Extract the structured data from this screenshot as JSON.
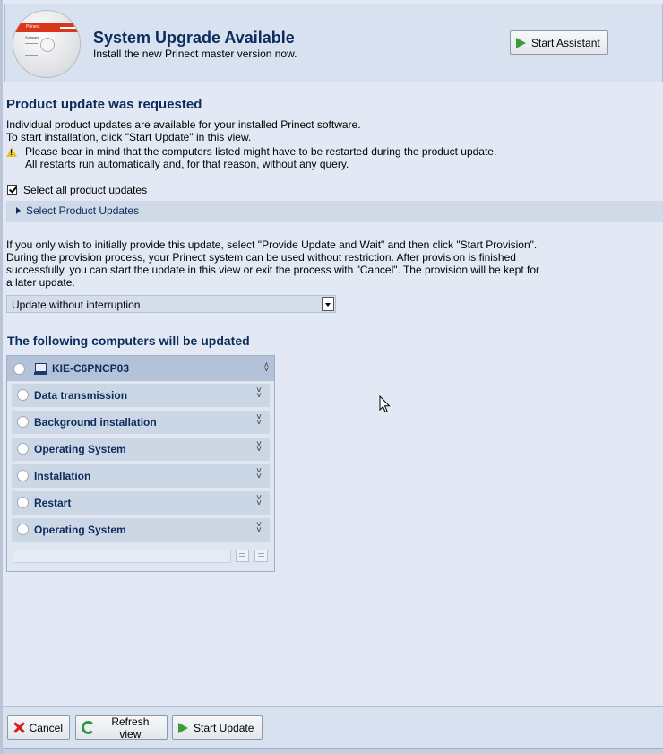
{
  "header": {
    "title": "System Upgrade Available",
    "subtitle": "Install the new Prinect master version now.",
    "assistant_button": "Start Assistant",
    "disc_label": "Prinect",
    "disc_sub": "Software"
  },
  "section": {
    "title": "Product update was requested",
    "line1": "Individual product updates are available for your installed Prinect software.",
    "line2": "To start installation, click \"Start Update\" in this view.",
    "warning1": "Please bear in mind that the computers listed might have to be restarted during the product update.",
    "warning2": "All restarts run automatically and, for that reason, without any query.",
    "select_all_label": "Select all product updates",
    "select_all_checked": true,
    "accordion_label": "Select Product Updates"
  },
  "provision": {
    "line1": "If you only wish to initially provide this update, select \"Provide Update and Wait\" and then click \"Start Provision\".",
    "line2": "During the provision process, your Prinect system can be used without restriction. After provision is finished",
    "line3": "successfully, you can start the update in this view or exit the process with \"Cancel\". The provision will be kept for",
    "line4": "a later update.",
    "mode_selected": "Update without interruption"
  },
  "computers": {
    "title": "The following computers will be updated",
    "computer_name": "KIE-C6PNCP03",
    "steps": [
      {
        "label": "Data transmission"
      },
      {
        "label": "Background installation"
      },
      {
        "label": "Operating System"
      },
      {
        "label": "Installation"
      },
      {
        "label": "Restart"
      },
      {
        "label": "Operating System"
      }
    ]
  },
  "footer": {
    "cancel": "Cancel",
    "refresh": "Refresh view",
    "start_update": "Start Update"
  },
  "colors": {
    "accent": "#0b2c5c",
    "background": "#e3e9f4",
    "play_green": "#3e9b38",
    "cancel_red": "#d32020"
  }
}
